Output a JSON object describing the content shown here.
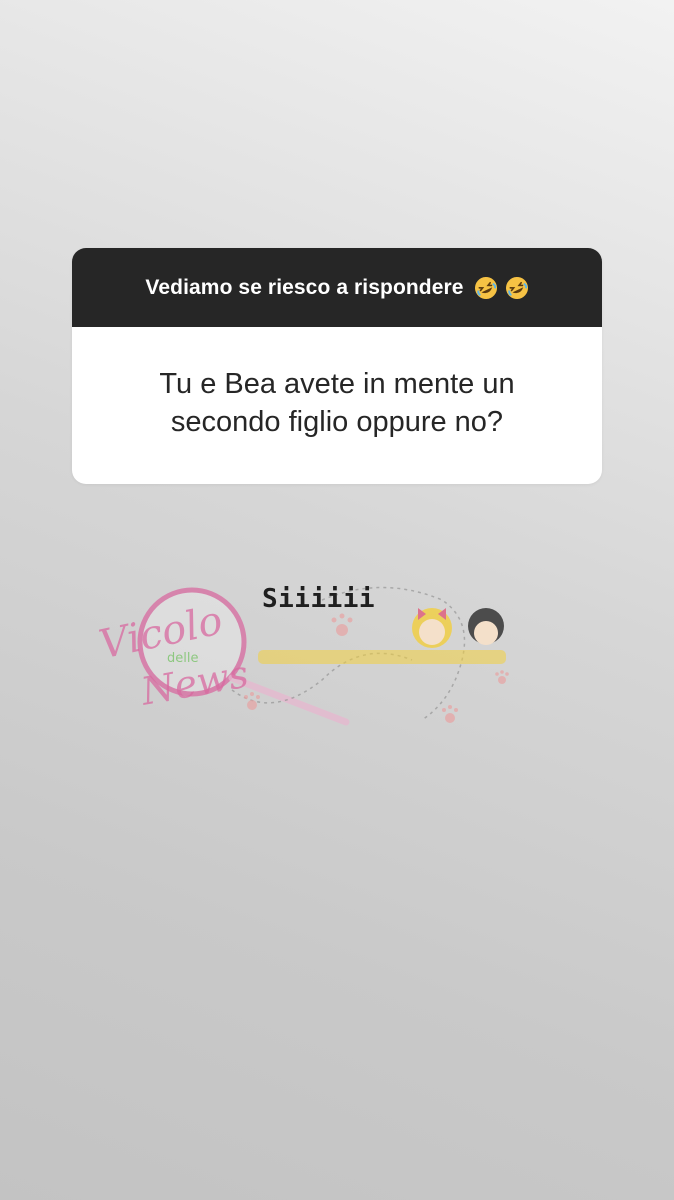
{
  "question_sticker": {
    "prompt": "Vediamo se riesco a rispondere",
    "prompt_emojis": [
      "rolling-laughing-emoji",
      "rolling-laughing-emoji"
    ],
    "question": "Tu e Bea avete in mente un secondo figlio oppure no?"
  },
  "answer": {
    "text": "Siiiiii"
  },
  "watermark": {
    "logo_text_line1": "Vicolo",
    "logo_text_line2": "delle",
    "logo_text_line3": "News",
    "accent_color": "#d86aa0"
  },
  "colors": {
    "header_bg": "#262626",
    "body_bg": "#ffffff",
    "question_text": "#262626"
  }
}
